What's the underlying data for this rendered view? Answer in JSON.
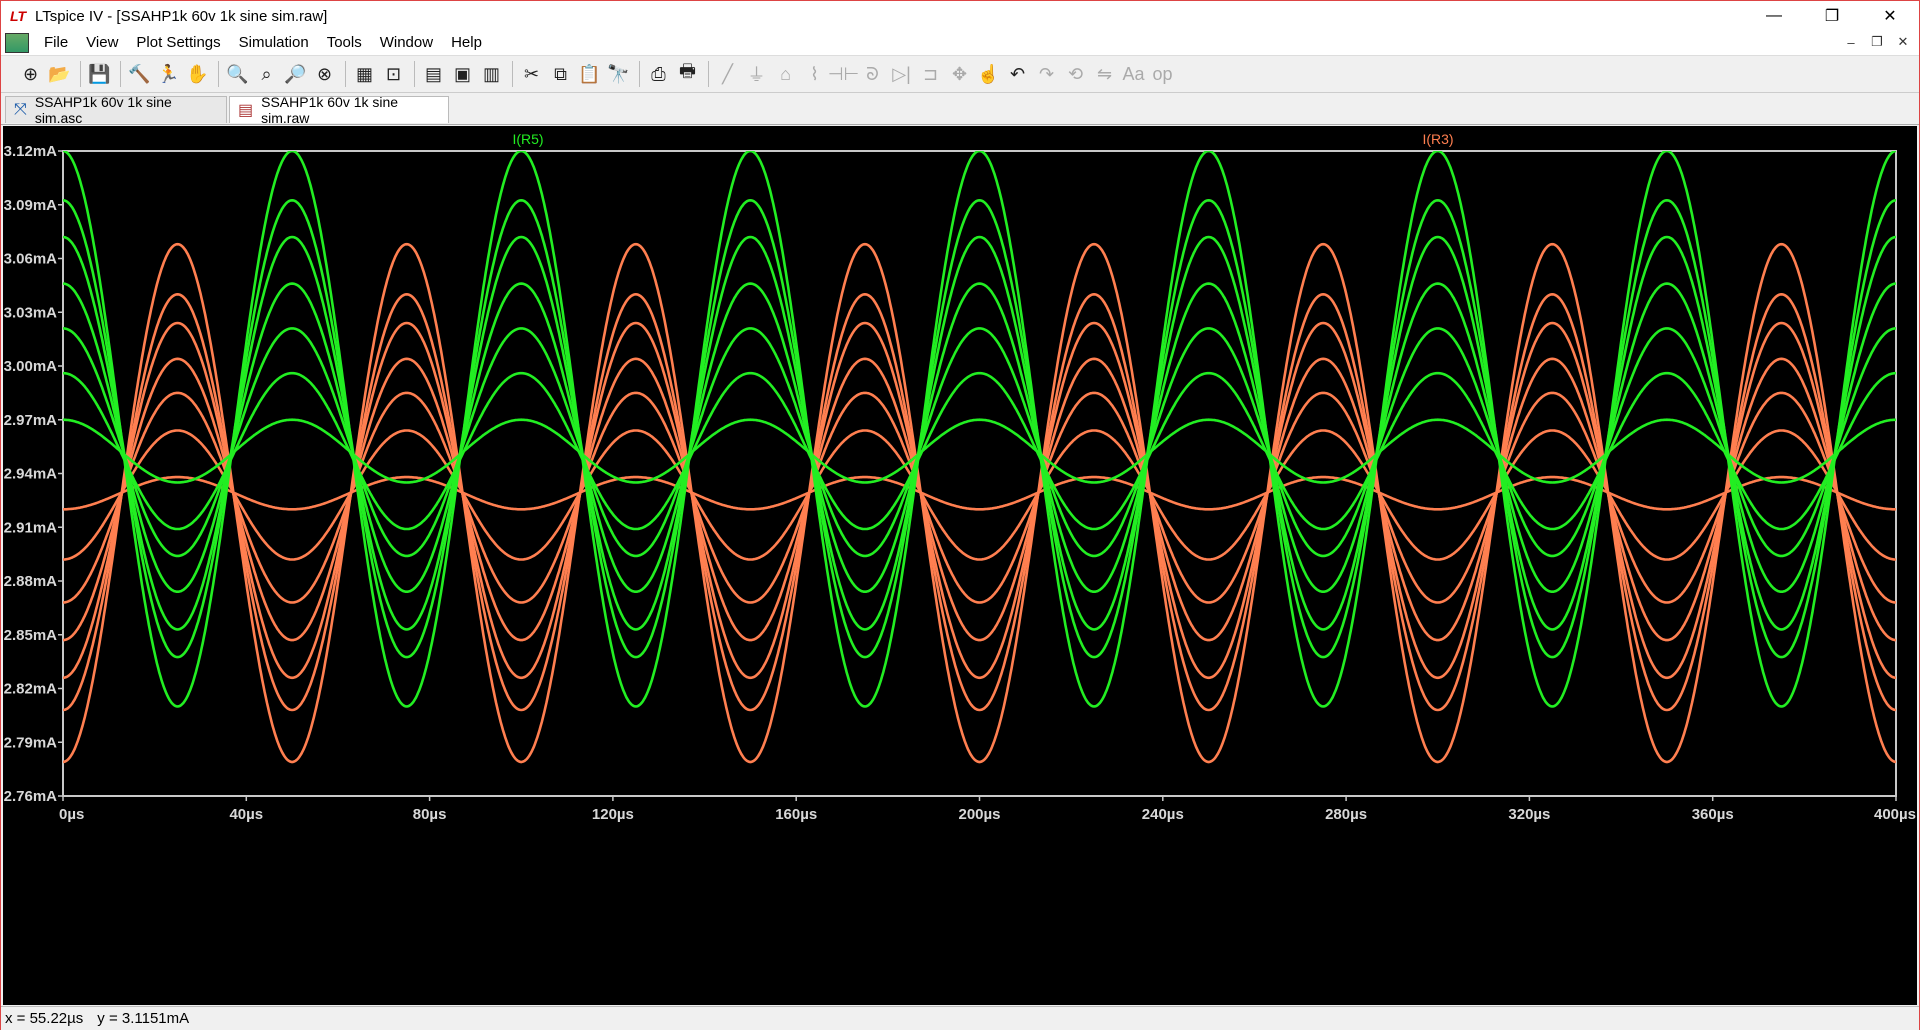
{
  "window": {
    "title": "LTspice IV - [SSAHP1k 60v 1k sine sim.raw]",
    "app_icon": "ltspice-logo-icon",
    "min_glyph": "—",
    "max_glyph": "❐",
    "close_glyph": "✕"
  },
  "menu": {
    "items": [
      "File",
      "View",
      "Plot Settings",
      "Simulation",
      "Tools",
      "Window",
      "Help"
    ],
    "mdi": {
      "min": "–",
      "restore": "❐",
      "close": "✕"
    }
  },
  "toolbar": {
    "icons": [
      "new-schematic-icon",
      "open-icon",
      "|",
      "save-icon",
      "|",
      "control-panel-icon",
      "run-icon",
      "pan-icon",
      "|",
      "zoom-in-icon",
      "zoom-area-icon",
      "zoom-out-icon",
      "zoom-fit-icon",
      "|",
      "autorange-icon",
      "mark-icon",
      "|",
      "tile-horizontal-icon",
      "cascade-icon",
      "tile-vertical-icon",
      "|",
      "cut-icon",
      "copy-icon",
      "paste-icon",
      "find-icon",
      "|",
      "print-preview-icon",
      "print-icon",
      "|",
      "wire-icon",
      "ground-icon",
      "label-icon",
      "resistor-icon",
      "capacitor-icon",
      "inductor-icon",
      "diode-icon",
      "component-icon",
      "move-icon",
      "drag-icon",
      "undo-icon",
      "redo-icon",
      "rotate-icon",
      "mirror-icon",
      "text-icon",
      "spice-directive-icon"
    ],
    "glyphs": {
      "new-schematic-icon": "⊕",
      "open-icon": "📂",
      "save-icon": "💾",
      "control-panel-icon": "🔨",
      "run-icon": "🏃",
      "pan-icon": "✋",
      "zoom-in-icon": "🔍",
      "zoom-area-icon": "⌕",
      "zoom-out-icon": "🔎",
      "zoom-fit-icon": "⊗",
      "autorange-icon": "▦",
      "mark-icon": "⊡",
      "tile-horizontal-icon": "▤",
      "cascade-icon": "▣",
      "tile-vertical-icon": "▥",
      "cut-icon": "✂",
      "copy-icon": "⧉",
      "paste-icon": "📋",
      "find-icon": "🔭",
      "print-preview-icon": "⎙",
      "print-icon": "🖶",
      "wire-icon": "╱",
      "ground-icon": "⏚",
      "label-icon": "⌂",
      "resistor-icon": "⌇",
      "capacitor-icon": "⊣⊢",
      "inductor-icon": "ᘐ",
      "diode-icon": "▷|",
      "component-icon": "⊐",
      "move-icon": "✥",
      "drag-icon": "☝",
      "undo-icon": "↶",
      "redo-icon": "↷",
      "rotate-icon": "⟲",
      "mirror-icon": "⇋",
      "text-icon": "Aa",
      "spice-directive-icon": "op"
    }
  },
  "tabs": [
    {
      "label": "SSAHP1k 60v 1k sine sim.asc",
      "icon": "schematic-icon",
      "active": false
    },
    {
      "label": "SSAHP1k 60v 1k sine sim.raw",
      "icon": "waveform-icon",
      "active": true
    }
  ],
  "status": {
    "x_readout": "x = 55.22µs",
    "y_readout": "y = 3.1151mA"
  },
  "chart_data": {
    "type": "line",
    "title": "",
    "background": "#000000",
    "xlim": [
      0,
      400
    ],
    "x_unit": "µs",
    "x_ticks": [
      "0µs",
      "40µs",
      "80µs",
      "120µs",
      "160µs",
      "200µs",
      "240µs",
      "280µs",
      "320µs",
      "360µs",
      "400µs"
    ],
    "ylim": [
      2.76,
      3.12
    ],
    "y_unit": "mA",
    "y_ticks": [
      "3.12mA",
      "3.09mA",
      "3.06mA",
      "3.03mA",
      "3.00mA",
      "2.97mA",
      "2.94mA",
      "2.91mA",
      "2.88mA",
      "2.85mA",
      "2.82mA",
      "2.79mA",
      "2.76mA"
    ],
    "grid": false,
    "frequency_khz": 20,
    "legend_placement": "top",
    "series": [
      {
        "name": "I(R5)",
        "color": "#22ee22",
        "phase": "cos",
        "traces": [
          {
            "mid": 2.9525,
            "amp": 0.0175
          },
          {
            "mid": 2.9525,
            "amp": 0.0435
          },
          {
            "mid": 2.9575,
            "amp": 0.0635
          },
          {
            "mid": 2.96,
            "amp": 0.086
          },
          {
            "mid": 2.9625,
            "amp": 0.1095
          },
          {
            "mid": 2.965,
            "amp": 0.1275
          },
          {
            "mid": 2.965,
            "amp": 0.155
          }
        ]
      },
      {
        "name": "I(R3)",
        "color": "#ff7f50",
        "phase": "-cos",
        "traces": [
          {
            "mid": 2.929,
            "amp": 0.009
          },
          {
            "mid": 2.928,
            "amp": 0.036
          },
          {
            "mid": 2.9265,
            "amp": 0.0585
          },
          {
            "mid": 2.9255,
            "amp": 0.0785
          },
          {
            "mid": 2.925,
            "amp": 0.099
          },
          {
            "mid": 2.924,
            "amp": 0.116
          },
          {
            "mid": 2.9235,
            "amp": 0.1445
          }
        ]
      }
    ]
  }
}
